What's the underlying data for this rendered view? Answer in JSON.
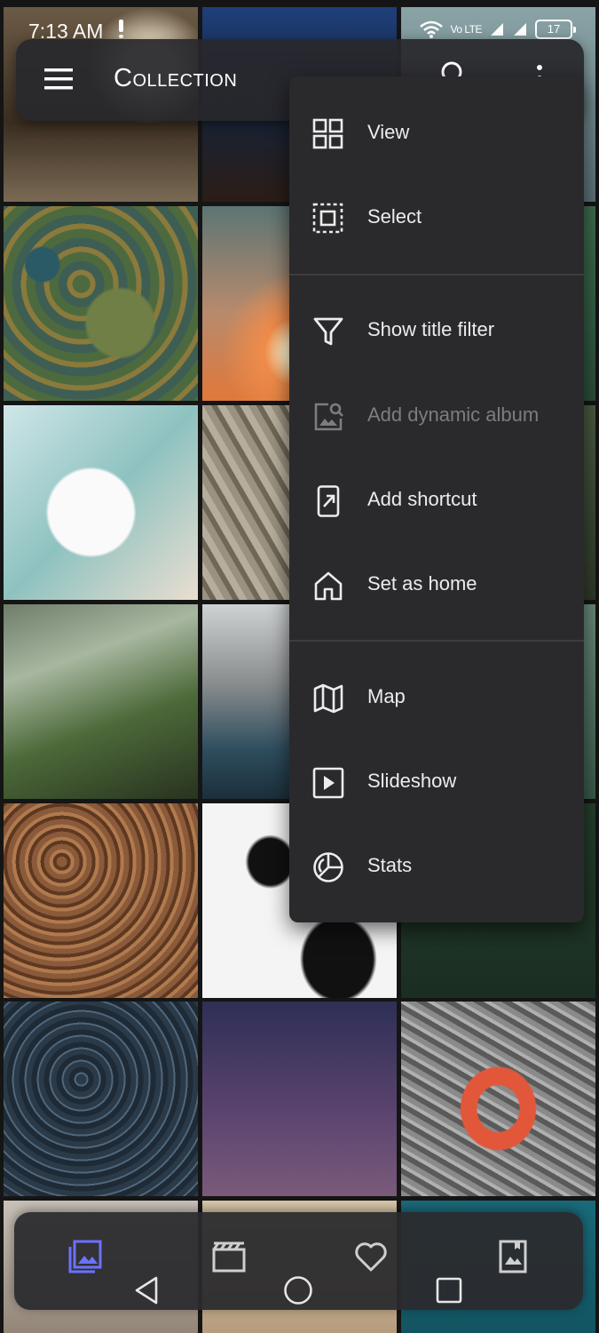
{
  "status_bar": {
    "time": "7:13 AM",
    "signal": "Vo LTE",
    "battery": "17"
  },
  "app_bar": {
    "title": "Collection"
  },
  "menu": {
    "items": [
      {
        "label": "View",
        "icon": "grid-view-icon",
        "enabled": true
      },
      {
        "label": "Select",
        "icon": "select-all-icon",
        "enabled": true
      },
      {
        "label": "Show title filter",
        "icon": "filter-icon",
        "enabled": true
      },
      {
        "label": "Add dynamic album",
        "icon": "image-search-icon",
        "enabled": false
      },
      {
        "label": "Add shortcut",
        "icon": "shortcut-icon",
        "enabled": true
      },
      {
        "label": "Set as home",
        "icon": "home-icon",
        "enabled": true
      },
      {
        "label": "Map",
        "icon": "map-icon",
        "enabled": true
      },
      {
        "label": "Slideshow",
        "icon": "slideshow-icon",
        "enabled": true
      },
      {
        "label": "Stats",
        "icon": "stats-pie-icon",
        "enabled": true
      }
    ]
  },
  "bottom_nav": {
    "items": [
      {
        "name": "collection-icon",
        "active": true
      },
      {
        "name": "videos-icon",
        "active": false
      },
      {
        "name": "favourites-icon",
        "active": false
      },
      {
        "name": "albums-icon",
        "active": false
      }
    ]
  },
  "colors": {
    "accent": "#6b72ff",
    "menu_background": "#2a2a2d",
    "text_primary": "#ececec",
    "text_disabled": "#7d7d80"
  }
}
